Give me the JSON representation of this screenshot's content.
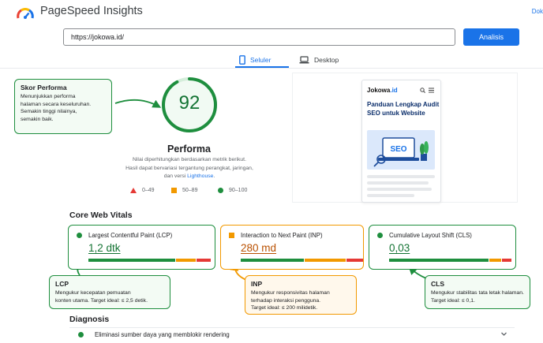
{
  "header": {
    "app_title": "PageSpeed Insights",
    "doc_link": "Dok",
    "logo_icon": "pagespeed-logo-icon"
  },
  "search": {
    "url_value": "https://jokowa.id/",
    "analyze_label": "Analisis"
  },
  "tabs": [
    {
      "label": "Seluler",
      "icon": "smartphone-icon",
      "active": true
    },
    {
      "label": "Desktop",
      "icon": "laptop-icon",
      "active": false
    }
  ],
  "score": {
    "value": "92",
    "fraction": 0.92,
    "label": "Performa",
    "desc_line1": "Nilai diperhitungkan berdasarkan metrik berikut.",
    "desc_line2": "Hasil dapat bervariasi tergantung perangkat, jaringan,",
    "desc_line3_prefix": "dan versi ",
    "desc_link": "Lighthouse",
    "desc_line3_suffix": "."
  },
  "legend": [
    {
      "range": "0–49",
      "shape": "triangle",
      "color": "#e53935"
    },
    {
      "range": "50–89",
      "shape": "square",
      "color": "#f29900"
    },
    {
      "range": "90–100",
      "shape": "circle",
      "color": "#1e8e3e"
    }
  ],
  "preview": {
    "brand_name": "Jokowa",
    "brand_suffix": ".id",
    "title": "Panduan Lengkap Audit SEO untuk Website",
    "hero_text": "SEO"
  },
  "callouts": {
    "skor": {
      "title": "Skor Performa",
      "text": [
        "Menunjukkan performa",
        "halaman secara keseluruhan.",
        "Semakin tinggi nilainya,",
        "semakin baik."
      ]
    },
    "lcp": {
      "title": "LCP",
      "text": [
        "Mengukur kecepatan pemuatan",
        "konten utama. Target ideal: ≤ 2,5 detik."
      ]
    },
    "inp": {
      "title": "INP",
      "text": [
        "Mengukur responsivitas halaman",
        "terhadap interaksi pengguna.",
        "Target ideal: ≤ 200 milidetik."
      ]
    },
    "cls": {
      "title": "CLS",
      "text": [
        "Mengukur stabilitas tata letak halaman.",
        "Target ideal: ≤ 0,1."
      ]
    }
  },
  "core_web_vitals": {
    "heading": "Core Web Vitals",
    "metrics": [
      {
        "name": "Largest Contentful Paint (LCP)",
        "value": "1,2 dtk",
        "status": "good",
        "distribution": {
          "good": 0.72,
          "needs_improvement": 0.16,
          "poor": 0.12
        }
      },
      {
        "name": "Interaction to Next Paint (INP)",
        "value": "280 md",
        "status": "needs-improvement",
        "distribution": {
          "good": 0.52,
          "needs_improvement": 0.34,
          "poor": 0.14
        }
      },
      {
        "name": "Cumulative Layout Shift (CLS)",
        "value": "0,03",
        "status": "good",
        "distribution": {
          "good": 0.82,
          "needs_improvement": 0.1,
          "poor": 0.08
        }
      }
    ]
  },
  "diagnosis": {
    "heading": "Diagnosis",
    "items": [
      {
        "label": "Eliminasi sumber daya yang memblokir rendering",
        "status": "good"
      }
    ]
  },
  "colors": {
    "accent": "#1a73e8",
    "good": "#1e8e3e",
    "average": "#f29900",
    "poor": "#e53935"
  }
}
